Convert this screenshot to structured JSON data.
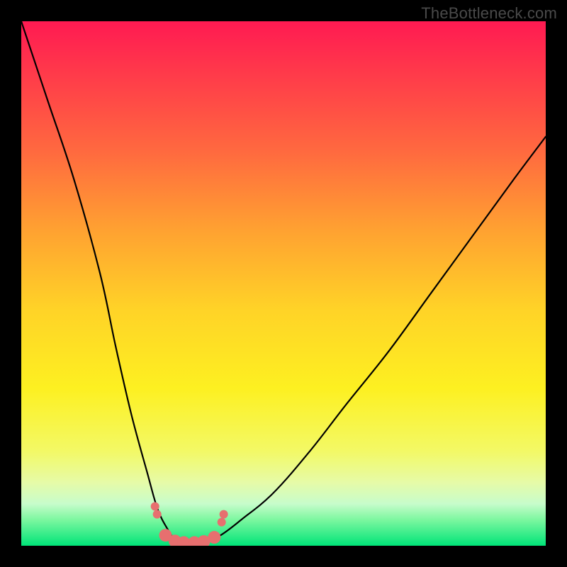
{
  "watermark": "TheBottleneck.com",
  "chart_data": {
    "type": "line",
    "title": "",
    "xlabel": "",
    "ylabel": "",
    "xlim": [
      0,
      100
    ],
    "ylim": [
      0,
      100
    ],
    "series": [
      {
        "name": "bottleneck-curve",
        "x": [
          0,
          5,
          10,
          15,
          18,
          21,
          24,
          26,
          28,
          29.5,
          31,
          33,
          35,
          38,
          42,
          48,
          55,
          62,
          70,
          78,
          86,
          94,
          100
        ],
        "values": [
          100,
          85,
          70,
          52,
          38,
          25,
          14,
          7,
          3,
          1,
          0.6,
          0.6,
          0.8,
          2,
          5,
          10,
          18,
          27,
          37,
          48,
          59,
          70,
          78
        ]
      }
    ],
    "markers": {
      "name": "highlight-points",
      "color": "#e76f6f",
      "radius_small": 6,
      "radius_large": 9,
      "points": [
        {
          "x": 25.5,
          "y": 7.5,
          "r": "small"
        },
        {
          "x": 25.9,
          "y": 6.0,
          "r": "small"
        },
        {
          "x": 27.5,
          "y": 2.0,
          "r": "large"
        },
        {
          "x": 29.3,
          "y": 0.9,
          "r": "large"
        },
        {
          "x": 31.0,
          "y": 0.6,
          "r": "large"
        },
        {
          "x": 33.0,
          "y": 0.6,
          "r": "large"
        },
        {
          "x": 34.8,
          "y": 0.8,
          "r": "large"
        },
        {
          "x": 36.8,
          "y": 1.6,
          "r": "large"
        },
        {
          "x": 38.2,
          "y": 4.5,
          "r": "small"
        },
        {
          "x": 38.6,
          "y": 6.0,
          "r": "small"
        }
      ]
    }
  }
}
